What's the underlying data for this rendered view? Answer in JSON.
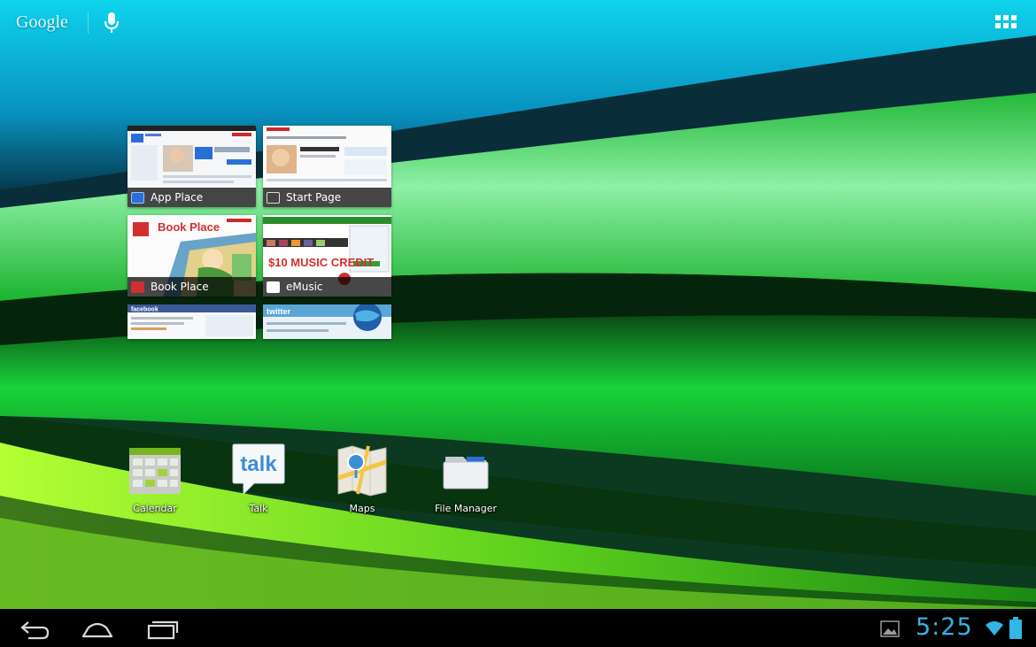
{
  "top_bar": {
    "google_label": "Google",
    "mic_icon": "microphone-icon",
    "apps_icon": "all-apps-grid-icon"
  },
  "bookmarks": [
    {
      "label": "App Place",
      "icon": "app-place-icon"
    },
    {
      "label": "Start Page",
      "icon": "start-page-icon"
    },
    {
      "label": "Book Place",
      "icon": "book-place-icon"
    },
    {
      "label": "eMusic",
      "icon": "emusic-icon"
    },
    {
      "label": "",
      "icon": "facebook-page"
    },
    {
      "label": "",
      "icon": "twitter-page"
    }
  ],
  "thumb_text": {
    "bookplace": "Book Place",
    "music": "$10 MUSIC CREDIT",
    "facebook": "facebook",
    "twitter": "twitter"
  },
  "apps": [
    {
      "label": "Calendar",
      "icon": "calendar-icon"
    },
    {
      "label": "Talk",
      "icon": "talk-icon"
    },
    {
      "label": "Maps",
      "icon": "maps-icon"
    },
    {
      "label": "File Manager",
      "icon": "folder-icon"
    }
  ],
  "talk_icon_text": "talk",
  "system_bar": {
    "time": "5:25",
    "nav": [
      "back-icon",
      "home-icon",
      "recent-apps-icon"
    ],
    "tray": [
      "screenshot-notification-icon",
      "wifi-icon",
      "battery-icon"
    ]
  },
  "colors": {
    "clock": "#33b5e5",
    "wallpaper_top": "#08b6d6",
    "wallpaper_green": "#1fbf3a"
  }
}
